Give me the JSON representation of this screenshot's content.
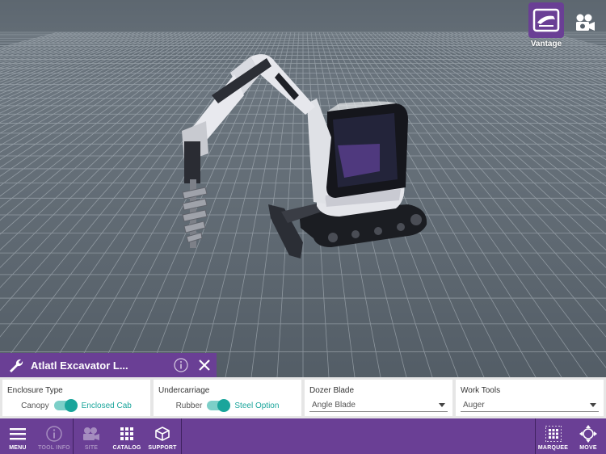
{
  "top_controls": {
    "vantage_label": "Vantage",
    "vantage_icon": "vantage-view-icon",
    "camera_icon": "video-camera-icon"
  },
  "colors": {
    "accent": "#6a3f95",
    "toggle_on": "#1aa59b",
    "viewport_background": "#56616b"
  },
  "item_panel": {
    "title": "Atlatl Excavator L...",
    "info_icon": "info-icon",
    "close_icon": "close-icon",
    "wrench_icon": "wrench-icon"
  },
  "options": {
    "enclosure": {
      "label": "Enclosure Type",
      "off_label": "Canopy",
      "on_label": "Enclosed Cab",
      "value": "Enclosed Cab"
    },
    "undercarriage": {
      "label": "Undercarriage",
      "off_label": "Rubber",
      "on_label": "Steel Option",
      "value": "Steel Option"
    },
    "dozer_blade": {
      "label": "Dozer Blade",
      "selected": "Angle Blade"
    },
    "work_tools": {
      "label": "Work Tools",
      "selected": "Auger"
    }
  },
  "toolbar": {
    "menu": "MENU",
    "tool_info": "TOOL INFO",
    "site": "SITE",
    "catalog": "CATALOG",
    "support": "SUPPORT",
    "marquee": "MARQUEE",
    "move": "MOVE"
  }
}
